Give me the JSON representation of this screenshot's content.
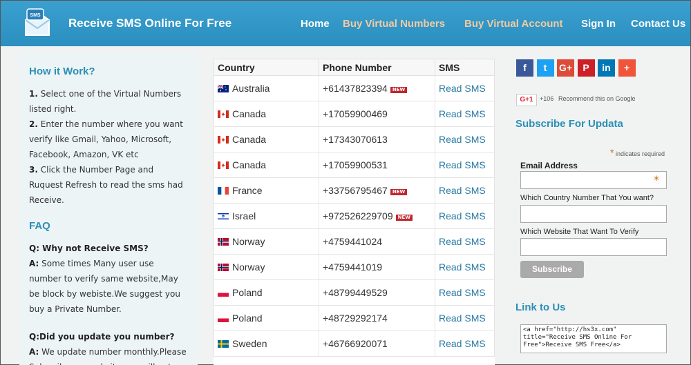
{
  "header": {
    "brand": "Receive SMS Online For Free",
    "nav": [
      "Home",
      "Buy Virtual Numbers",
      "Buy Virtual Account",
      "Sign In",
      "Contact Us"
    ],
    "logo_text": "SMS"
  },
  "left": {
    "how_title": "How it Work?",
    "steps": [
      {
        "num": "1.",
        "text": " Select one of the Virtual Numbers listed right."
      },
      {
        "num": "2.",
        "text": " Enter the number where you want verify like Gmail, Yahoo, Microsoft, Facebook, Amazon, VK etc"
      },
      {
        "num": "3.",
        "text": " Click the Number Page and Ruquest Refresh to read the sms had Receive."
      }
    ],
    "faq_title": "FAQ",
    "q1": "Q: Why not Receive SMS?",
    "a1_label": "A:",
    "a1": " Some times Many user use number to verify same website,May be block by webiste.We suggest you buy a Private Number.",
    "q2": "Q:Did you update you number?",
    "a2_label": "A:",
    "a2": " We update number monthly.Please Subscribe our website you will got"
  },
  "table": {
    "headers": [
      "Country",
      "Phone Number",
      "SMS"
    ],
    "new_badge": "NEW",
    "rows": [
      {
        "country": "Australia",
        "flag": "au",
        "phone": "+61437823394",
        "isnew": true,
        "sms": "Read SMS"
      },
      {
        "country": "Canada",
        "flag": "ca",
        "phone": "+17059900469",
        "isnew": false,
        "sms": "Read SMS"
      },
      {
        "country": "Canada",
        "flag": "ca",
        "phone": "+17343070613",
        "isnew": false,
        "sms": "Read SMS"
      },
      {
        "country": "Canada",
        "flag": "ca",
        "phone": "+17059900531",
        "isnew": false,
        "sms": "Read SMS"
      },
      {
        "country": "France",
        "flag": "fr",
        "phone": "+33756795467",
        "isnew": true,
        "sms": "Read SMS"
      },
      {
        "country": "Israel",
        "flag": "il",
        "phone": "+972526229709",
        "isnew": true,
        "sms": "Read SMS"
      },
      {
        "country": "Norway",
        "flag": "no",
        "phone": "+4759441024",
        "isnew": false,
        "sms": "Read SMS"
      },
      {
        "country": "Norway",
        "flag": "no",
        "phone": "+4759441019",
        "isnew": false,
        "sms": "Read SMS"
      },
      {
        "country": "Poland",
        "flag": "pl",
        "phone": "+48799449529",
        "isnew": false,
        "sms": "Read SMS"
      },
      {
        "country": "Poland",
        "flag": "pl",
        "phone": "+48729292174",
        "isnew": false,
        "sms": "Read SMS"
      },
      {
        "country": "Sweden",
        "flag": "se",
        "phone": "+46766920071",
        "isnew": false,
        "sms": "Read SMS"
      }
    ]
  },
  "right": {
    "social": [
      {
        "name": "facebook",
        "glyph": "f",
        "color": "#3b5998"
      },
      {
        "name": "twitter",
        "glyph": "t",
        "color": "#1da1f2"
      },
      {
        "name": "google-plus",
        "glyph": "G+",
        "color": "#dd4b39"
      },
      {
        "name": "pinterest",
        "glyph": "P",
        "color": "#cb2027"
      },
      {
        "name": "linkedin",
        "glyph": "in",
        "color": "#0077b5"
      },
      {
        "name": "more",
        "glyph": "+",
        "color": "#f0553b"
      }
    ],
    "gplus_label": "G+1",
    "gplus_count": "+106",
    "gplus_text": "Recommend this on Google",
    "subscribe_title": "Subscribe For Updata",
    "required_note": "indicates required",
    "email_label": "Email Address",
    "country_label": "Which Country Number That You want?",
    "website_label": "Which Website That Want To Verify",
    "subscribe_button": "Subscribe",
    "link_title": "Link to Us",
    "link_code": "<a href=\"http://hs3x.com\" title=\"Receive SMS Online For Free\">Receive SMS Free</a>"
  },
  "colors": {
    "header": "#3aa0cf",
    "accent_nav": "#f3c9a2",
    "heading": "#2a8fb5",
    "link": "#2a7aa3",
    "new_badge": "#c0262c"
  }
}
